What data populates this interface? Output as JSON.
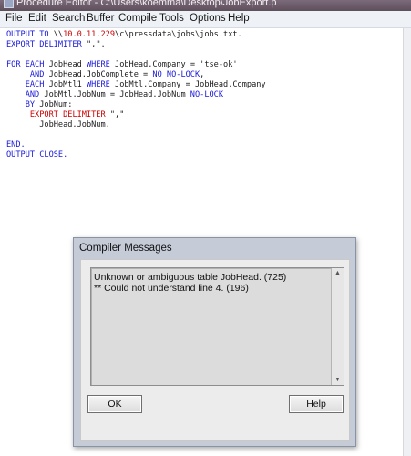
{
  "window": {
    "title": "Procedure Editor - C:\\Users\\koemma\\Desktop\\JobExport.p"
  },
  "menu": [
    "File",
    "Edit",
    "Search",
    "Buffer",
    "Compile",
    "Tools",
    "Options",
    "Help"
  ],
  "code": [
    {
      "parts": [
        {
          "t": "kw",
          "v": "OUTPUT TO "
        },
        {
          "t": "id",
          "v": "\\\\"
        },
        {
          "t": "str",
          "v": "10.0.11.229"
        },
        {
          "t": "id",
          "v": "\\c\\pressdata\\jobs\\jobs.txt."
        }
      ]
    },
    {
      "parts": [
        {
          "t": "kw",
          "v": "EXPORT DELIMITER "
        },
        {
          "t": "id",
          "v": "\",\"."
        }
      ]
    },
    {
      "parts": []
    },
    {
      "parts": [
        {
          "t": "kw",
          "v": "FOR EACH "
        },
        {
          "t": "id",
          "v": "JobHead "
        },
        {
          "t": "kw",
          "v": "WHERE "
        },
        {
          "t": "id",
          "v": "JobHead.Company = 'tse-ok'"
        }
      ]
    },
    {
      "parts": [
        {
          "t": "id",
          "v": "     "
        },
        {
          "t": "kw",
          "v": "AND "
        },
        {
          "t": "id",
          "v": "JobHead.JobComplete = "
        },
        {
          "t": "kw",
          "v": "NO NO-LOCK"
        },
        {
          "t": "id",
          "v": ","
        }
      ]
    },
    {
      "parts": [
        {
          "t": "id",
          "v": "    "
        },
        {
          "t": "kw",
          "v": "EACH "
        },
        {
          "t": "id",
          "v": "JobMtl1 "
        },
        {
          "t": "kw",
          "v": "WHERE "
        },
        {
          "t": "id",
          "v": "JobMtl.Company = JobHead.Company"
        }
      ]
    },
    {
      "parts": [
        {
          "t": "id",
          "v": "    "
        },
        {
          "t": "kw",
          "v": "AND "
        },
        {
          "t": "id",
          "v": "JobMtl.JobNum = JobHead.JobNum "
        },
        {
          "t": "kw",
          "v": "NO-LOCK"
        }
      ]
    },
    {
      "parts": [
        {
          "t": "id",
          "v": "    "
        },
        {
          "t": "kw",
          "v": "BY "
        },
        {
          "t": "id",
          "v": "JobNum:"
        }
      ]
    },
    {
      "parts": [
        {
          "t": "id",
          "v": "     "
        },
        {
          "t": "str",
          "v": "EXPORT DELIMITER "
        },
        {
          "t": "id",
          "v": "\",\""
        }
      ]
    },
    {
      "parts": [
        {
          "t": "id",
          "v": "       JobHead.JobNum."
        }
      ]
    },
    {
      "parts": []
    },
    {
      "parts": [
        {
          "t": "kw",
          "v": "END."
        }
      ]
    },
    {
      "parts": [
        {
          "t": "kw",
          "v": "OUTPUT CLOSE."
        }
      ]
    }
  ],
  "dialog": {
    "title": "Compiler Messages",
    "messages": [
      "Unknown or ambiguous table JobHead. (725)",
      "** Could not understand line 4. (196)"
    ],
    "ok_label": "OK",
    "help_label": "Help"
  }
}
